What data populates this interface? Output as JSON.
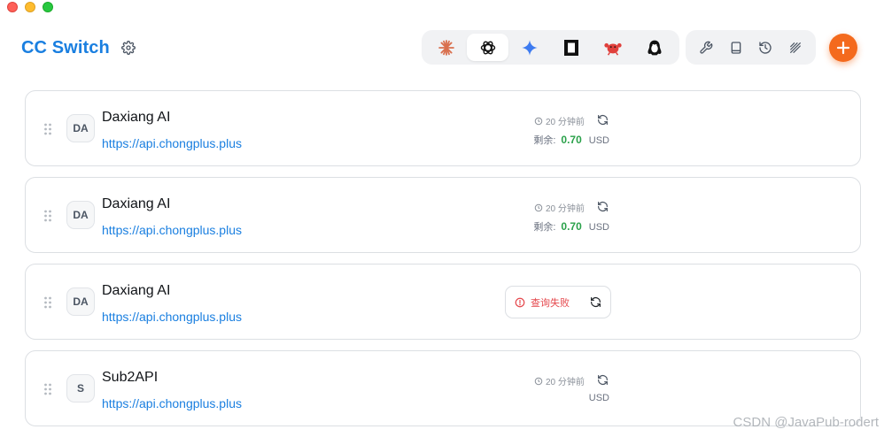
{
  "app": {
    "title": "CC Switch"
  },
  "app_switcher": {
    "apps": [
      {
        "name": "claude-icon",
        "active": false
      },
      {
        "name": "openai-icon",
        "active": true
      },
      {
        "name": "gemini-icon",
        "active": false
      },
      {
        "name": "opencode-icon",
        "active": false
      },
      {
        "name": "crab-icon",
        "active": false
      },
      {
        "name": "penguin-icon",
        "active": false
      }
    ]
  },
  "tools": [
    "wrench-icon",
    "book-icon",
    "history-icon",
    "prompt-icon"
  ],
  "colors": {
    "brand": "#1a7fe0",
    "accent": "#f46a1d",
    "success": "#2aa14a",
    "error": "#e5484d"
  },
  "providers": [
    {
      "badge": "DA",
      "name": "Daxiang AI",
      "url": "https://api.chongplus.plus",
      "status": "ok",
      "updated": "20 分钟前",
      "balance_label": "剩余:",
      "balance_value": "0.70",
      "currency": "USD"
    },
    {
      "badge": "DA",
      "name": "Daxiang AI",
      "url": "https://api.chongplus.plus",
      "status": "ok",
      "updated": "20 分钟前",
      "balance_label": "剩余:",
      "balance_value": "0.70",
      "currency": "USD"
    },
    {
      "badge": "DA",
      "name": "Daxiang AI",
      "url": "https://api.chongplus.plus",
      "status": "error",
      "error_text": "查询失败"
    },
    {
      "badge": "S",
      "name": "Sub2API",
      "url": "https://api.chongplus.plus",
      "status": "ok",
      "updated": "20 分钟前",
      "currency": "USD"
    }
  ],
  "watermark": "CSDN @JavaPub-rodert"
}
